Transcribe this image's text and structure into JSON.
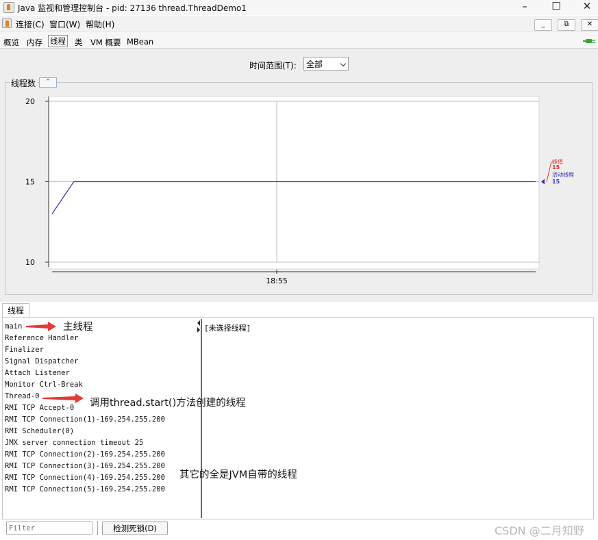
{
  "window": {
    "title": "Java 监视和管理控制台 - pid: 27136 thread.ThreadDemo1",
    "controls": {
      "minimize": "–",
      "maximize": "☐",
      "close": "✕"
    }
  },
  "menu": {
    "items": [
      "连接(C)",
      "窗口(W)",
      "帮助(H)"
    ],
    "mdi_controls": [
      "_",
      "⧉",
      "✕"
    ]
  },
  "tabs": {
    "items": [
      "概览",
      "内存",
      "线程",
      "类",
      "VM 概要",
      "MBean"
    ],
    "selected": "线程"
  },
  "time_range": {
    "label": "时间范围(T):",
    "value": "全部"
  },
  "chart_section": {
    "title": "线程数",
    "collapse_glyph": "⌃"
  },
  "chart_data": {
    "type": "line",
    "title": "线程数",
    "ylim": [
      10,
      20
    ],
    "yticks": [
      10,
      15,
      20
    ],
    "xticks": [
      "18:55"
    ],
    "series": [
      {
        "name": "峰值",
        "color": "#e03030",
        "value": 15
      },
      {
        "name": "活动线程",
        "color": "#3030b0",
        "value": 15
      }
    ],
    "points": [
      [
        0,
        13
      ],
      [
        0.045,
        15
      ],
      [
        1.0,
        15
      ]
    ]
  },
  "threads": {
    "tab_label": "线程",
    "list": [
      "main",
      "Reference Handler",
      "Finalizer",
      "Signal Dispatcher",
      "Attach Listener",
      "Monitor Ctrl-Break",
      "Thread-0",
      "RMI TCP Accept-0",
      "RMI TCP Connection(1)-169.254.255.200",
      "RMI Scheduler(0)",
      "JMX server connection timeout 25",
      "RMI TCP Connection(2)-169.254.255.200",
      "RMI TCP Connection(3)-169.254.255.200",
      "RMI TCP Connection(4)-169.254.255.200",
      "RMI TCP Connection(5)-169.254.255.200"
    ],
    "detail_placeholder": "[未选择线程]",
    "filter_placeholder": "Filter",
    "deadlock_button": "检测死锁(D)"
  },
  "annotations": {
    "main_thread": "主线程",
    "thread0": "调用thread.start()方法创建的线程",
    "jvm_threads": "其它的全是JVM自带的线程",
    "arrow_color": "#e53935"
  },
  "watermark": "CSDN @二月知野",
  "colors": {
    "peak": "#e03030",
    "active": "#3030b0",
    "connected_icon": "#3aa33a"
  }
}
